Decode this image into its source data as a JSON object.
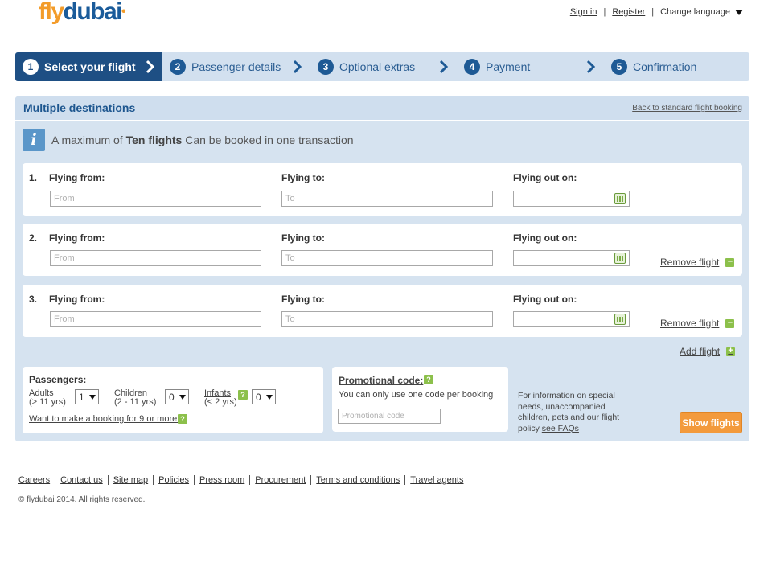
{
  "header": {
    "logo_fly": "fly",
    "logo_dubai": "dubai",
    "sign_in": "Sign in",
    "register": "Register",
    "change_language": "Change language"
  },
  "steps": [
    {
      "num": "1",
      "label": "Select your flight",
      "active": true
    },
    {
      "num": "2",
      "label": "Passenger details",
      "active": false
    },
    {
      "num": "3",
      "label": "Optional extras",
      "active": false
    },
    {
      "num": "4",
      "label": "Payment",
      "active": false
    },
    {
      "num": "5",
      "label": "Confirmation",
      "active": false
    }
  ],
  "panel": {
    "title": "Multiple destinations",
    "back_link": "Back to standard flight booking",
    "info_icon": "i",
    "info_prefix": "A maximum of ",
    "info_bold": "Ten flights",
    "info_suffix": " Can be booked in one transaction"
  },
  "flights": [
    {
      "num": "1.",
      "from_label": "Flying from:",
      "from_placeholder": "From",
      "to_label": "Flying to:",
      "to_placeholder": "To",
      "date_label": "Flying out on:",
      "remove": null
    },
    {
      "num": "2.",
      "from_label": "Flying from:",
      "from_placeholder": "From",
      "to_label": "Flying to:",
      "to_placeholder": "To",
      "date_label": "Flying out on:",
      "remove": "Remove flight"
    },
    {
      "num": "3.",
      "from_label": "Flying from:",
      "from_placeholder": "From",
      "to_label": "Flying to:",
      "to_placeholder": "To",
      "date_label": "Flying out on:",
      "remove": "Remove flight"
    }
  ],
  "add_flight": "Add flight",
  "passengers": {
    "title": "Passengers:",
    "adults_label": "Adults",
    "adults_range": "(> 11 yrs)",
    "adults_value": "1",
    "children_label": "Children",
    "children_range": "(2 - 11 yrs)",
    "children_value": "0",
    "infants_label": "Infants",
    "infants_range": "(< 2 yrs)",
    "infants_value": "0",
    "help_badge": "?",
    "group_link": "Want to make a booking for 9 or more?"
  },
  "promo": {
    "title": "Promotional code:",
    "note": "You can only use one code per booking",
    "placeholder": "Promotional code"
  },
  "faq": {
    "text": "For information on special needs, unaccompanied children, pets and our flight policy",
    "link": "see FAQs"
  },
  "show_flights": "Show flights",
  "footer": {
    "links": [
      "Careers",
      "Contact us",
      "Site map",
      "Policies",
      "Press room",
      "Procurement",
      "Terms and conditions",
      "Travel agents"
    ],
    "copyright": "© flydubai 2014. All rights reserved."
  },
  "colors": {
    "brand_orange": "#f39a3c",
    "brand_blue": "#1e4f84",
    "panel_bg": "#d6e3f0",
    "accent_green": "#8cc04b"
  }
}
